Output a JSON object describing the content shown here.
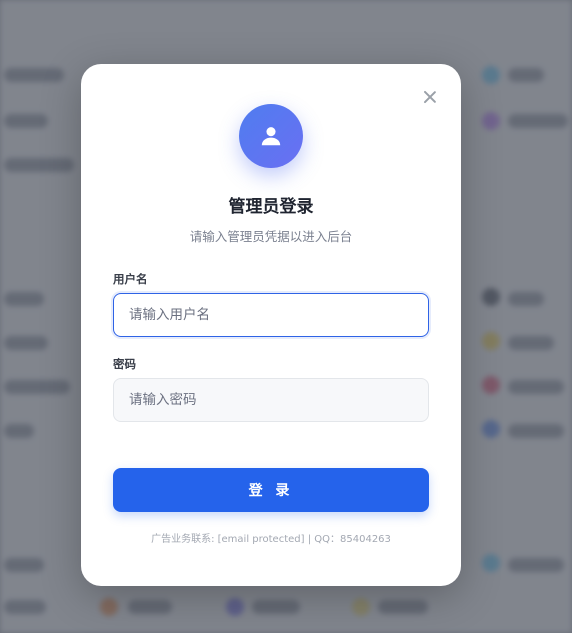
{
  "modal": {
    "title": "管理员登录",
    "subtitle": "请输入管理员凭据以进入后台",
    "username_label": "用户名",
    "username_placeholder": "请输入用户名",
    "username_value": "",
    "password_label": "密码",
    "password_placeholder": "请输入密码",
    "password_value": "",
    "login_label": "登 录",
    "footer": "广告业务联系: [email protected] | QQ：85404263"
  },
  "colors": {
    "accent": "#2563eb",
    "avatar_start": "#4f7df0",
    "avatar_end": "#6a6ff2"
  },
  "icons": {
    "avatar": "user-icon",
    "close": "close-icon"
  }
}
